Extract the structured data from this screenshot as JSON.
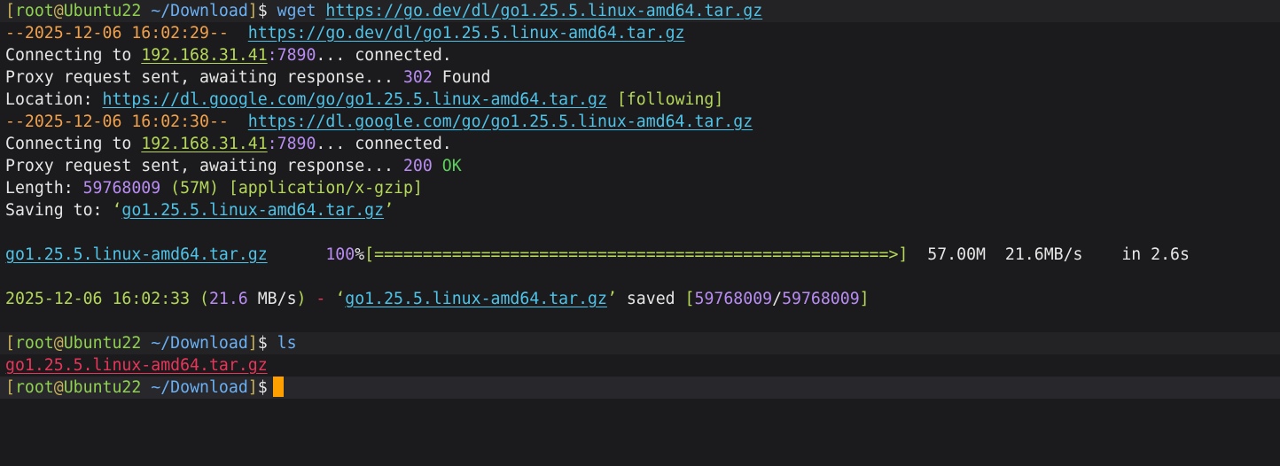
{
  "prompt": {
    "open": "[",
    "user": "root",
    "at": "@",
    "host": "Ubuntu22",
    "cwd": "~/Download",
    "close": "]",
    "sign": "$"
  },
  "cmd1": {
    "name": "wget",
    "url": "https://go.dev/dl/go1.25.5.linux-amd64.tar.gz"
  },
  "req1": {
    "ts": "--2025-12-06 16:02:29--",
    "url": "https://go.dev/dl/go1.25.5.linux-amd64.tar.gz"
  },
  "conn1": {
    "text": "Connecting to ",
    "ip": "192.168.31.41",
    "port": ":7890",
    "rest": "... connected."
  },
  "resp1": {
    "text": "Proxy request sent, awaiting response... ",
    "code": "302",
    "status": " Found"
  },
  "loc": {
    "label": "Location:",
    "url": "https://dl.google.com/go/go1.25.5.linux-amd64.tar.gz",
    "note": "[following]"
  },
  "req2": {
    "ts": "--2025-12-06 16:02:30--",
    "url": "https://dl.google.com/go/go1.25.5.linux-amd64.tar.gz"
  },
  "conn2": {
    "text": "Connecting to ",
    "ip": "192.168.31.41",
    "port": ":7890",
    "rest": "... connected."
  },
  "resp2": {
    "text": "Proxy request sent, awaiting response... ",
    "code": "200",
    "status": "OK"
  },
  "len": {
    "label": "Length:",
    "bytes": "59768009",
    "mb": "(57M)",
    "type": "[application/x-gzip]"
  },
  "save": {
    "label": "Saving to:",
    "q1": "‘",
    "file": "go1.25.5.linux-amd64.tar.gz",
    "q2": "’"
  },
  "progress": {
    "file": "go1.25.5.linux-amd64.tar.gz",
    "pct": "100",
    "pct_sign": "%",
    "bar": "[=====================================================>]",
    "size": "57.00M",
    "speed": "21.6MB/s",
    "time": "in 2.6s",
    "fraction": 1.0
  },
  "done": {
    "date": "2025-12-06 16:02:33",
    "p1": "(",
    "rate": "21.6",
    "unit": " MB/s",
    "p2": ")",
    "dash": " - ",
    "q1": "‘",
    "file": "go1.25.5.linux-amd64.tar.gz",
    "q2": "’",
    "saved": " saved ",
    "b1": "[",
    "n1": "59768009",
    "slash": "/",
    "n2": "59768009",
    "b2": "]"
  },
  "cmd2": {
    "name": "ls"
  },
  "ls_out": {
    "file": "go1.25.5.linux-amd64.tar.gz"
  },
  "colors": {
    "background": "#1b1b1d",
    "cursor": "#ffa000",
    "prompt_bracket": "#c9b25a",
    "prompt_user": "#8fd14f",
    "link": "#4fc3e8",
    "number": "#b88cf2",
    "archive": "#e8365a"
  }
}
